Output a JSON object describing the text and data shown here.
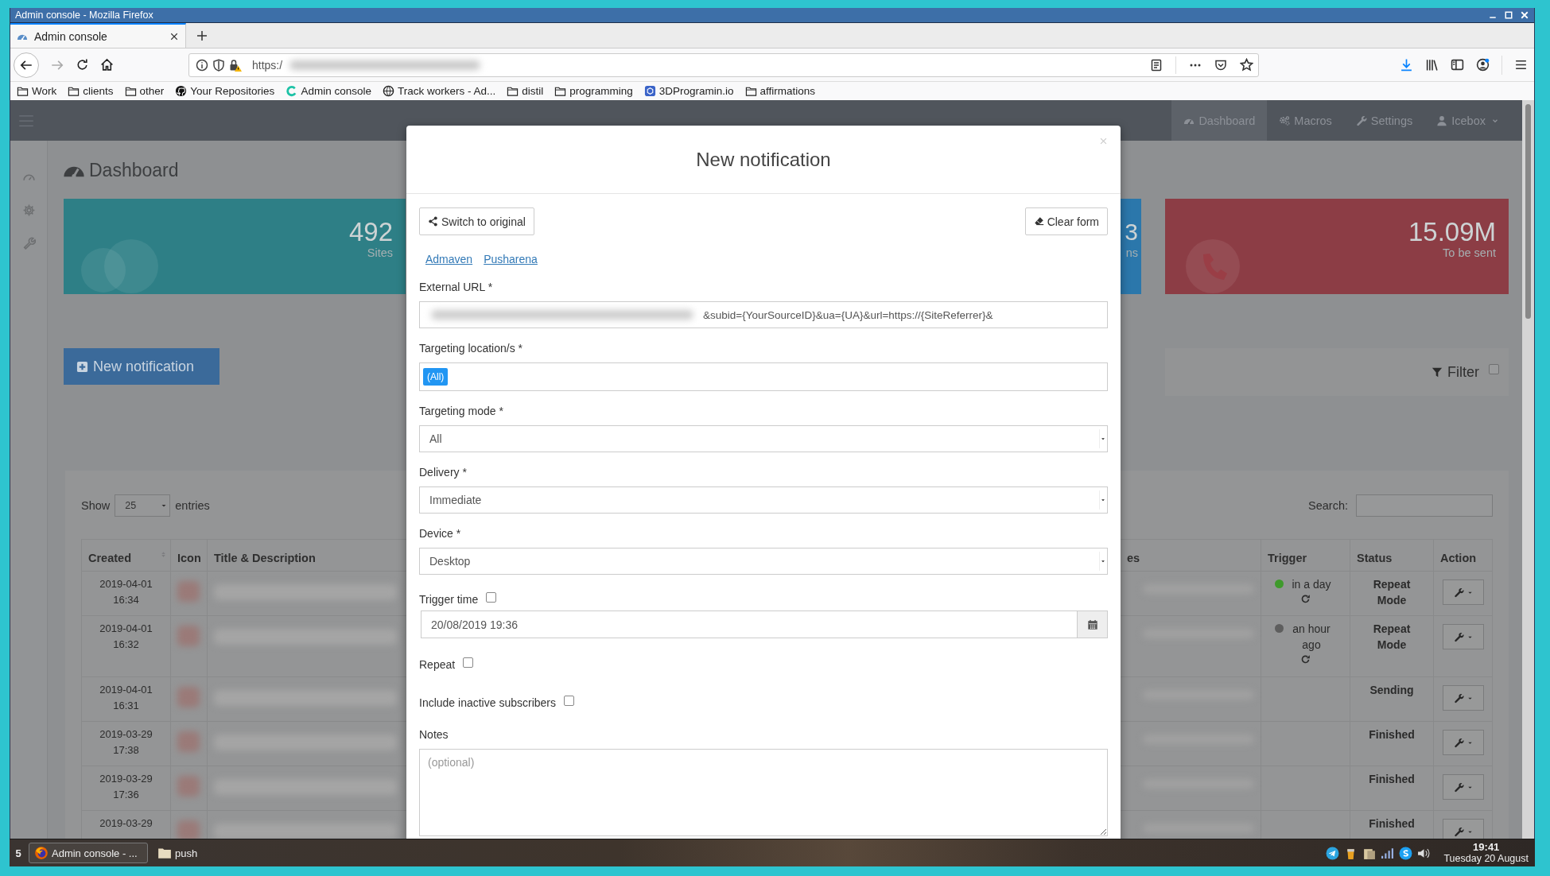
{
  "window": {
    "title": "Admin console - Mozilla Firefox"
  },
  "browser": {
    "tabs": [
      {
        "label": "Admin console",
        "selected": true
      }
    ],
    "address": {
      "text": "https:/",
      "redacted": true
    },
    "bookmarks": [
      {
        "label": "Work",
        "kind": "folder"
      },
      {
        "label": "clients",
        "kind": "folder"
      },
      {
        "label": "other",
        "kind": "folder"
      },
      {
        "label": "Your Repositories",
        "kind": "github"
      },
      {
        "label": "Admin console",
        "kind": "site"
      },
      {
        "label": "Track workers - Ad...",
        "kind": "globe"
      },
      {
        "label": "distil",
        "kind": "folder"
      },
      {
        "label": "programming",
        "kind": "folder"
      },
      {
        "label": "3DProgramin.io",
        "kind": "cube"
      },
      {
        "label": "affirmations",
        "kind": "folder"
      }
    ]
  },
  "app": {
    "navbar": [
      {
        "label": "Dashboard",
        "kind": "gauge",
        "selected": true
      },
      {
        "label": "Macros",
        "kind": "gears",
        "selected": false
      },
      {
        "label": "Settings",
        "kind": "wrench",
        "selected": false
      },
      {
        "label": "Icebox",
        "kind": "user",
        "selected": false
      }
    ],
    "page_title": "Dashboard",
    "stats": [
      {
        "value": "492",
        "label": "Sites",
        "color": "#2e7f86"
      },
      {
        "value": "3",
        "label": "ns",
        "color": "#2b77ab"
      },
      {
        "value": "15.09M",
        "label": "To be sent",
        "color": "#8c3d45"
      }
    ],
    "new_button": "New notification",
    "filter": {
      "label": "Filter",
      "checked": false
    },
    "table": {
      "show_label": "Show",
      "page_size": "25",
      "entries_label": "entries",
      "search_label": "Search:",
      "columns": [
        "Created",
        "Icon",
        "Title & Description",
        "es",
        "Trigger",
        "Status",
        "Action"
      ],
      "rows": [
        {
          "created": "2019-04-01 16:34",
          "trigger": {
            "text": "in a day",
            "color": "#3f9a2c",
            "repeat": true
          },
          "status": "Repeat Mode"
        },
        {
          "created": "2019-04-01 16:32",
          "trigger": {
            "text": "an hour ago",
            "color": "#5e5e5e",
            "repeat": true
          },
          "status": "Repeat Mode"
        },
        {
          "created": "2019-04-01 16:31",
          "status": "Sending"
        },
        {
          "created": "2019-03-29 17:38",
          "status": "Finished"
        },
        {
          "created": "2019-03-29 17:36",
          "status": "Finished"
        },
        {
          "created": "2019-03-29",
          "status": "Finished"
        }
      ]
    }
  },
  "modal": {
    "title": "New notification",
    "buttons": [
      {
        "label": "Switch to original",
        "kind": "share"
      },
      {
        "label": "Clear form",
        "kind": "eraser"
      }
    ],
    "links": [
      "Admaven",
      "Pusharena"
    ],
    "fields": [
      {
        "kind": "text",
        "label": "External URL *",
        "value": "&subid={YourSourceID}&ua={UA}&url=https://{SiteReferrer}&",
        "redacted": true
      },
      {
        "kind": "tags",
        "label": "Targeting location/s *",
        "tags": [
          "(All)"
        ]
      },
      {
        "kind": "select",
        "label": "Targeting mode *",
        "value": "All"
      },
      {
        "kind": "select",
        "label": "Delivery *",
        "value": "Immediate"
      },
      {
        "kind": "select",
        "label": "Device *",
        "value": "Desktop"
      },
      {
        "kind": "datetime",
        "label": "Trigger time",
        "checked": false,
        "value": "20/08/2019 19:36"
      },
      {
        "kind": "checkbox",
        "label": "Repeat",
        "checked": false
      },
      {
        "kind": "checkbox",
        "label": "Include inactive subscribers",
        "checked": false
      },
      {
        "kind": "textarea",
        "label": "Notes",
        "placeholder": "(optional)"
      }
    ]
  },
  "taskbar": {
    "workspace": "5",
    "tasks": [
      {
        "label": "Admin console - ...",
        "kind": "browser",
        "selected": true
      },
      {
        "label": "push",
        "kind": "folder",
        "selected": false
      }
    ],
    "clock": {
      "time": "19:41",
      "date": "Tuesday 20 August"
    }
  }
}
